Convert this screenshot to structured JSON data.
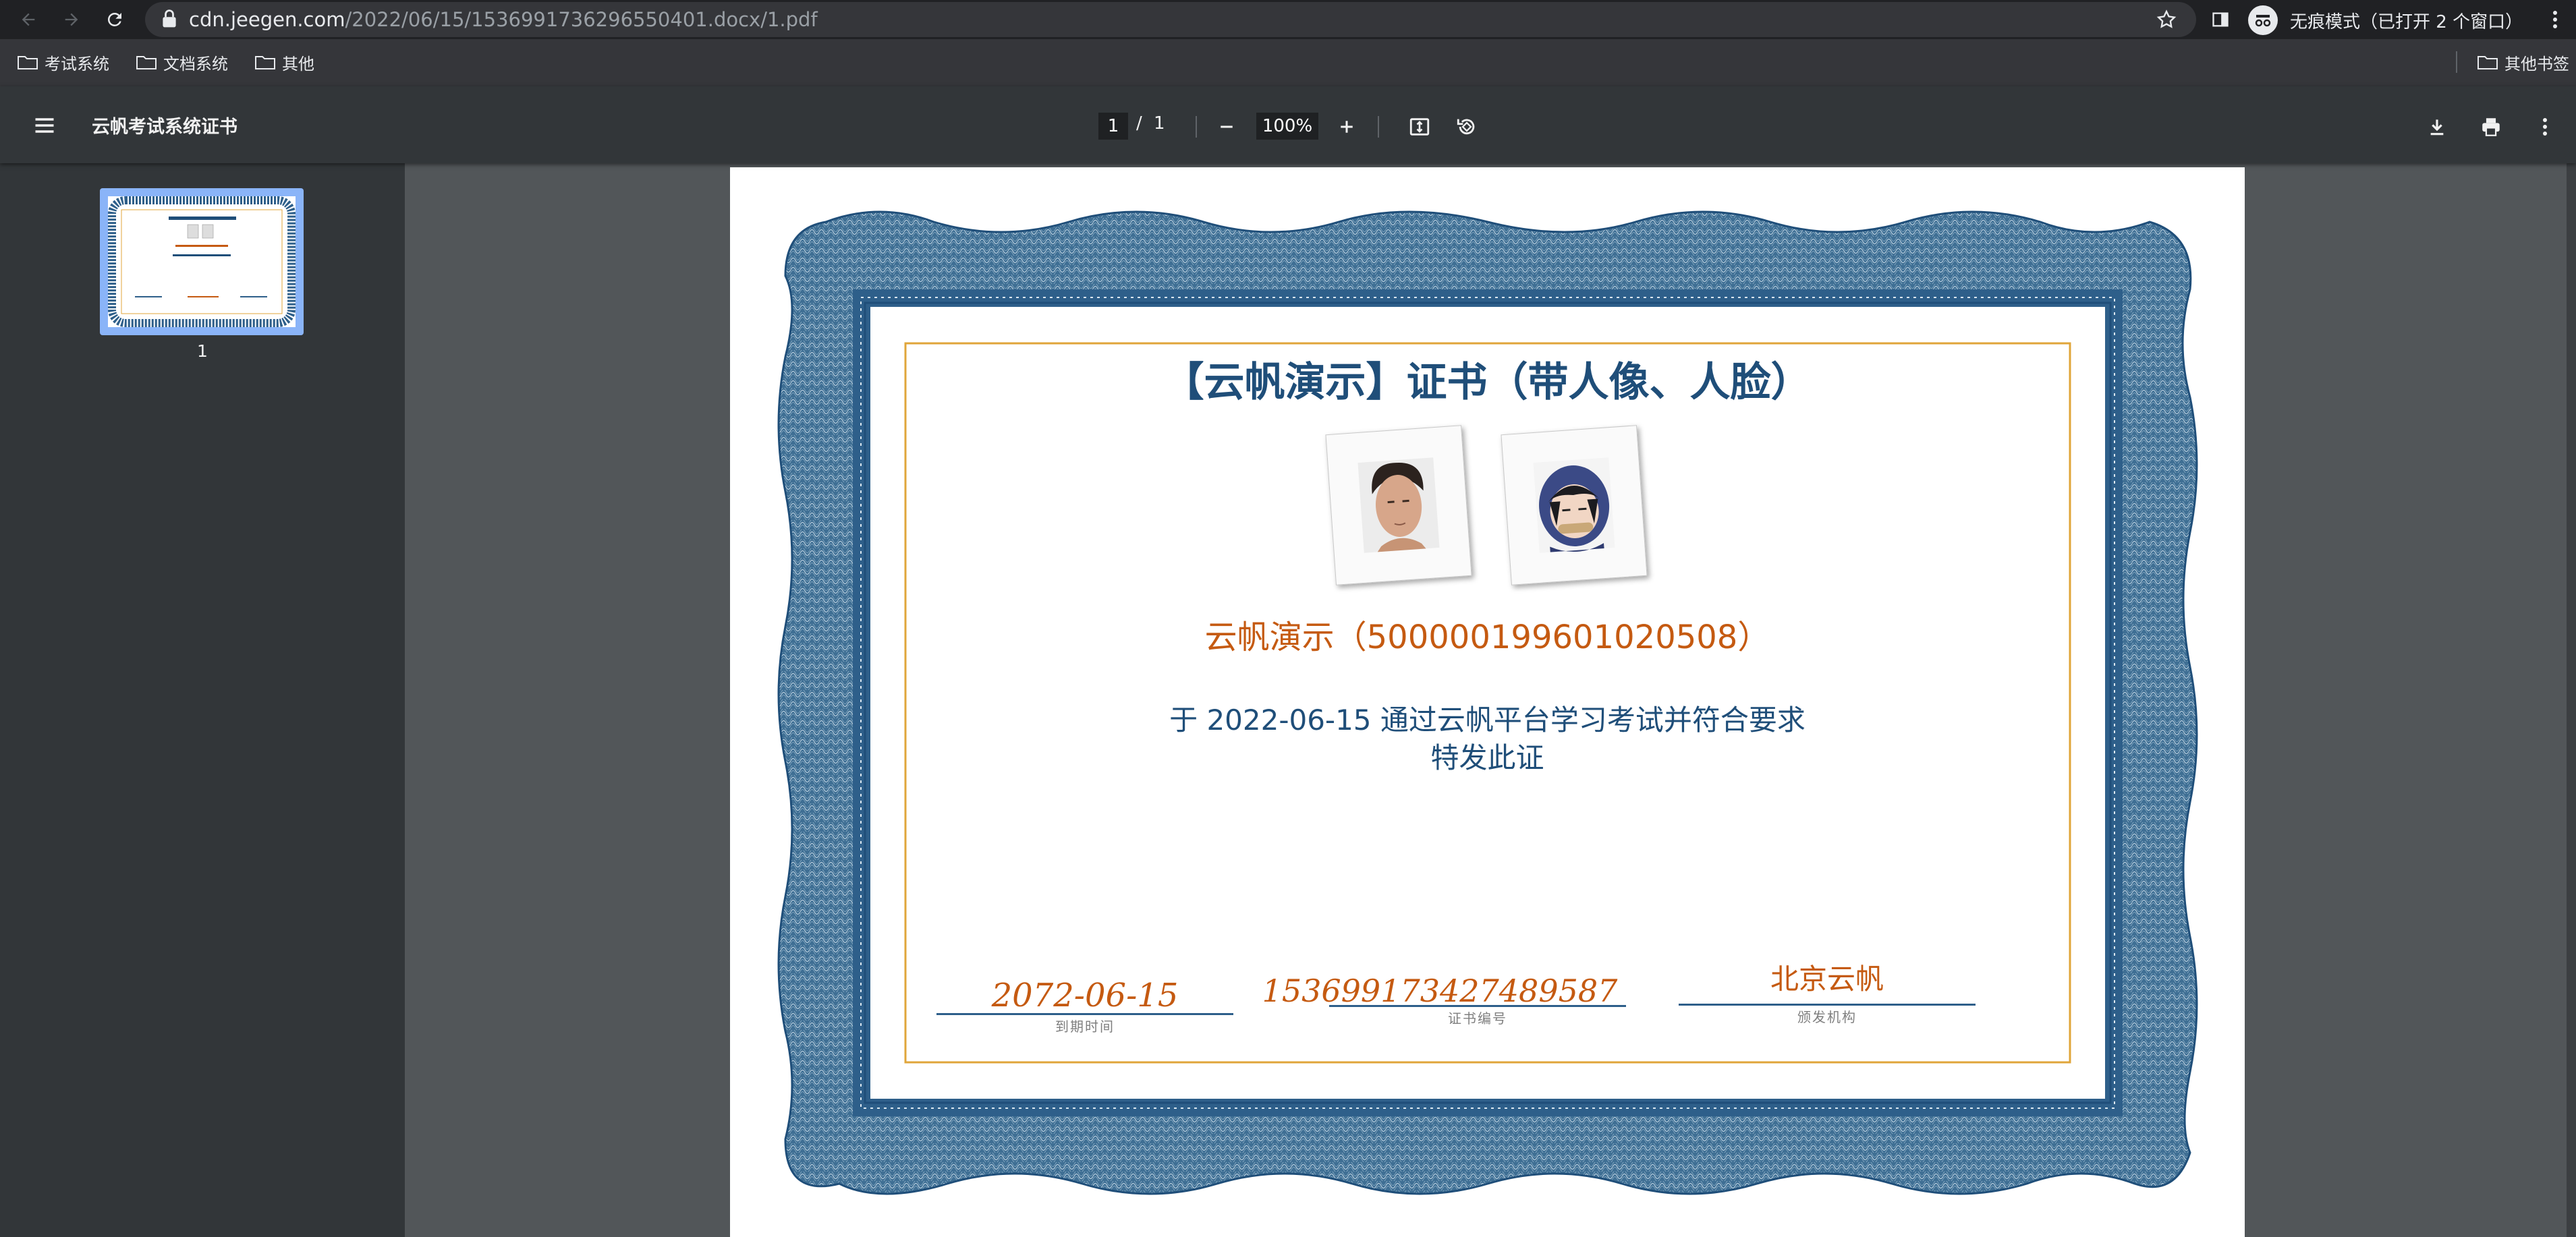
{
  "browser": {
    "url_host": "cdn.jeegen.com",
    "url_path": "/2022/06/15/1536991736296550401.docx/1.pdf",
    "incognito_label": "无痕模式（已打开 2 个窗口）",
    "bookmarks": [
      "考试系统",
      "文档系统",
      "其他"
    ],
    "other_bookmarks": "其他书签"
  },
  "viewer": {
    "title": "云帆考试系统证书",
    "current_page": "1",
    "page_separator": "/",
    "total_pages": "1",
    "zoom": "100%",
    "thumbnail_label": "1"
  },
  "certificate": {
    "title": "【云帆演示】证书（带人像、人脸）",
    "holder_line": "云帆演示（500000199601020508）",
    "pass_line": "于 2022-06-15 通过云帆平台学习考试并符合要求",
    "issue_line": "特发此证",
    "expiry_value": "2072-06-15",
    "expiry_caption": "到期时间",
    "cert_number_value": "1536991734274895​87",
    "cert_number_caption": "证书编号",
    "issuer_value": "北京云帆",
    "issuer_caption": "颁发机构"
  },
  "colors": {
    "border_blue": "#2e5f8a",
    "gold_frame": "#e0a53a",
    "title_blue": "#1f4e79",
    "accent_orange": "#c55a11"
  }
}
